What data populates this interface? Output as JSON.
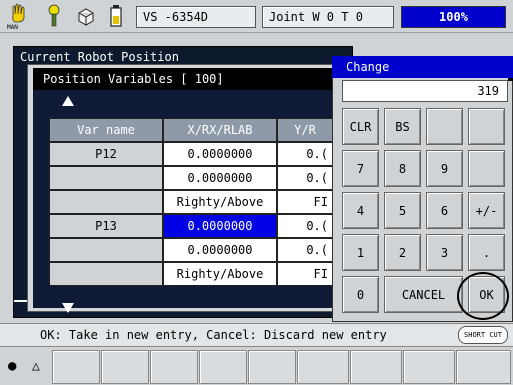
{
  "topbar": {
    "man_label": "MAN",
    "robot_field": "VS -6354D",
    "mode_field": "Joint  W 0 T 0",
    "speed": "100%"
  },
  "background": {
    "title": "Current Robot Position"
  },
  "position_vars": {
    "title": "Position Variables [  100]",
    "headers": [
      "Var name",
      "X/RX/RLAB",
      "Y/R"
    ],
    "rows": [
      [
        "P12",
        "0.0000000",
        "0.("
      ],
      [
        "",
        "0.0000000",
        "0.("
      ],
      [
        "",
        "Righty/Above",
        "FI"
      ],
      [
        "P13",
        "0.0000000",
        "0.("
      ],
      [
        "",
        "0.0000000",
        "0.("
      ],
      [
        "",
        "Righty/Above",
        "FI"
      ]
    ]
  },
  "dialog": {
    "title": "Change",
    "entry_value": "319",
    "keys": [
      [
        "CLR",
        "BS",
        "",
        ""
      ],
      [
        "7",
        "8",
        "9",
        ""
      ],
      [
        "4",
        "5",
        "6",
        "+/-"
      ],
      [
        "1",
        "2",
        "3",
        "."
      ],
      [
        "0",
        "CANCEL",
        "OK"
      ]
    ]
  },
  "status": {
    "message": "OK: Take in new entry, Cancel: Discard new entry",
    "shortcut_label": "SHORT CUT"
  },
  "bottom": {
    "dot": "●",
    "triangle": "△"
  }
}
